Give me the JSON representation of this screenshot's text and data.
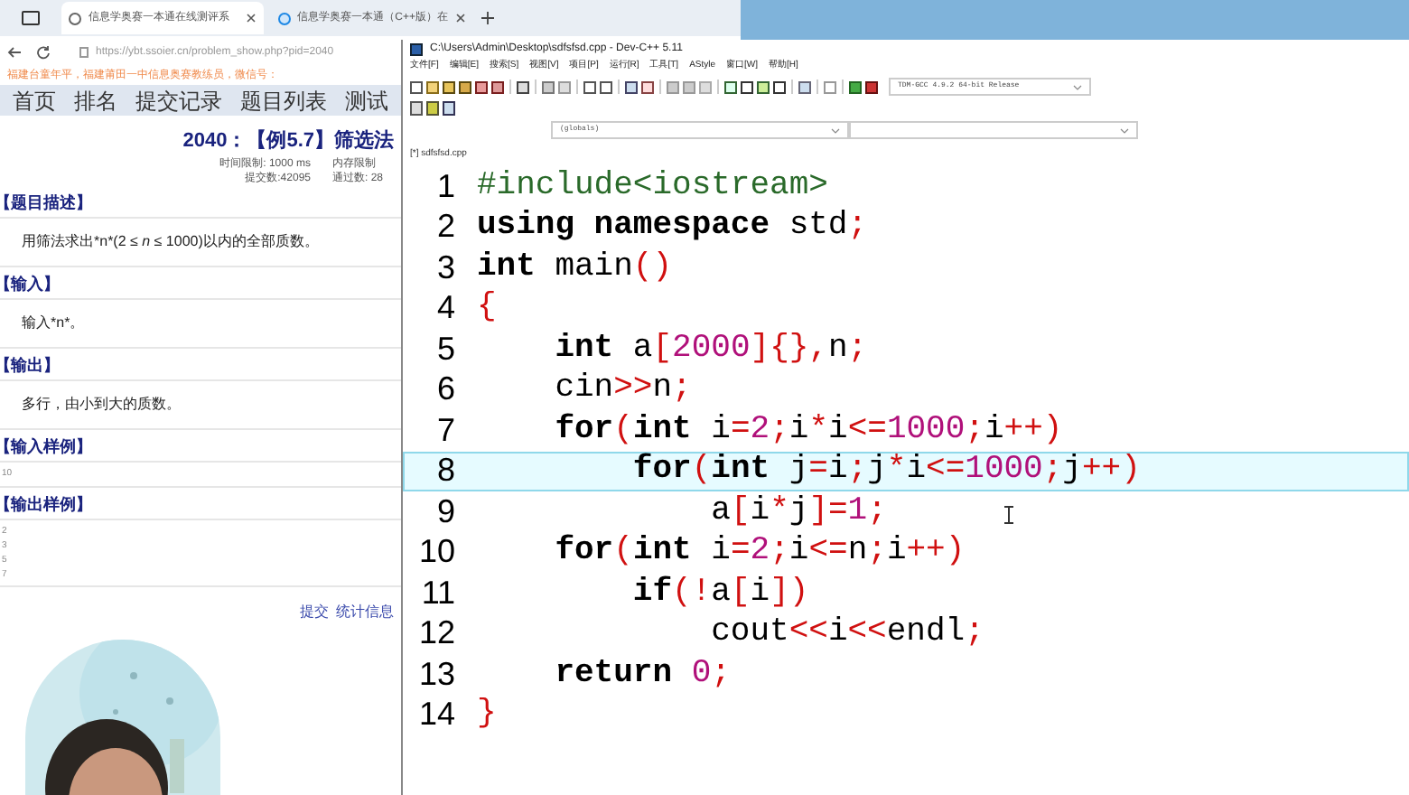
{
  "browser": {
    "tabs": [
      {
        "title": "信息学奥赛一本通在线测评系",
        "selected": true
      },
      {
        "title": "信息学奥赛一本通（C++版）在",
        "selected": false
      }
    ],
    "url": "https://ybt.ssoier.cn/problem_show.php?pid=2040",
    "notice": "福建台童年平，福建莆田一中信息奥赛教练员，微信号：",
    "nav": [
      {
        "label": "首页"
      },
      {
        "label": "排名"
      },
      {
        "label": "提交记录"
      },
      {
        "label": "题目列表"
      },
      {
        "label": "测试"
      }
    ],
    "problem": {
      "title": "2040：【例5.7】筛选法",
      "limits": [
        {
          "label": "时间限制: 1000 ms",
          "value": "内存限制"
        },
        {
          "label": "提交数:42095",
          "value": "通过数: 28"
        }
      ],
      "sections": [
        {
          "heading": "【题目描述】",
          "body": "用筛法求出*n*(2 ≤ *n* ≤ 1000)以内的全部质数。",
          "kind": "text"
        },
        {
          "heading": "【输入】",
          "body": "输入*n*。",
          "kind": "text"
        },
        {
          "heading": "【输出】",
          "body": "多行，由小到大的质数。",
          "kind": "text"
        },
        {
          "heading": "【输入样例】",
          "body": "10",
          "kind": "sample"
        },
        {
          "heading": "【输出样例】",
          "body": "2\n3\n5\n7",
          "kind": "sample"
        }
      ],
      "footer_links": [
        "提交",
        "统计信息"
      ]
    }
  },
  "editor": {
    "title": "C:\\Users\\Admin\\Desktop\\sdfsfsd.cpp - Dev-C++ 5.11",
    "menu": [
      "文件[F]",
      "编辑[E]",
      "搜索[S]",
      "视图[V]",
      "项目[P]",
      "运行[R]",
      "工具[T]",
      "AStyle",
      "窗口[W]",
      "帮助[H]"
    ],
    "compiler": "TDM-GCC 4.9.2 64-bit Release",
    "scope": "(globals)",
    "file_tab": "[*] sdfsfsd.cpp",
    "lines": [
      {
        "number": "1",
        "current": false,
        "tokens": [
          {
            "kind": "pre",
            "text": "#include<iostream>"
          }
        ]
      },
      {
        "number": "2",
        "current": false,
        "tokens": [
          {
            "kind": "kw",
            "text": "using namespace"
          },
          {
            "kind": "plain",
            "text": " std"
          },
          {
            "kind": "sym",
            "text": ";"
          }
        ]
      },
      {
        "number": "3",
        "current": false,
        "tokens": [
          {
            "kind": "kw",
            "text": "int"
          },
          {
            "kind": "plain",
            "text": " main"
          },
          {
            "kind": "sym",
            "text": "()"
          }
        ]
      },
      {
        "number": "4",
        "current": false,
        "tokens": [
          {
            "kind": "sym",
            "text": "{"
          }
        ]
      },
      {
        "number": "5",
        "current": false,
        "tokens": [
          {
            "kind": "kw",
            "text": "    int"
          },
          {
            "kind": "plain",
            "text": " a"
          },
          {
            "kind": "sym",
            "text": "["
          },
          {
            "kind": "num",
            "text": "2000"
          },
          {
            "kind": "sym",
            "text": "]{},"
          },
          {
            "kind": "plain",
            "text": "n"
          },
          {
            "kind": "sym",
            "text": ";"
          }
        ]
      },
      {
        "number": "6",
        "current": false,
        "tokens": [
          {
            "kind": "plain",
            "text": "    cin"
          },
          {
            "kind": "sym",
            "text": ">>"
          },
          {
            "kind": "plain",
            "text": "n"
          },
          {
            "kind": "sym",
            "text": ";"
          }
        ]
      },
      {
        "number": "7",
        "current": false,
        "tokens": [
          {
            "kind": "kw",
            "text": "    for"
          },
          {
            "kind": "sym",
            "text": "("
          },
          {
            "kind": "kw",
            "text": "int"
          },
          {
            "kind": "plain",
            "text": " i"
          },
          {
            "kind": "sym",
            "text": "="
          },
          {
            "kind": "num",
            "text": "2"
          },
          {
            "kind": "sym",
            "text": ";"
          },
          {
            "kind": "plain",
            "text": "i"
          },
          {
            "kind": "sym",
            "text": "*"
          },
          {
            "kind": "plain",
            "text": "i"
          },
          {
            "kind": "sym",
            "text": "<="
          },
          {
            "kind": "num",
            "text": "1000"
          },
          {
            "kind": "sym",
            "text": ";"
          },
          {
            "kind": "plain",
            "text": "i"
          },
          {
            "kind": "sym",
            "text": "++)"
          }
        ]
      },
      {
        "number": "8",
        "current": true,
        "tokens": [
          {
            "kind": "kw",
            "text": "        for"
          },
          {
            "kind": "sym",
            "text": "("
          },
          {
            "kind": "kw",
            "text": "int"
          },
          {
            "kind": "plain",
            "text": " j"
          },
          {
            "kind": "sym",
            "text": "="
          },
          {
            "kind": "plain",
            "text": "i"
          },
          {
            "kind": "sym",
            "text": ";"
          },
          {
            "kind": "plain",
            "text": "j"
          },
          {
            "kind": "sym",
            "text": "*"
          },
          {
            "kind": "plain",
            "text": "i"
          },
          {
            "kind": "sym",
            "text": "<="
          },
          {
            "kind": "num",
            "text": "1000"
          },
          {
            "kind": "sym",
            "text": ";"
          },
          {
            "kind": "plain",
            "text": "j"
          },
          {
            "kind": "sym",
            "text": "++)"
          }
        ]
      },
      {
        "number": "9",
        "current": false,
        "tokens": [
          {
            "kind": "plain",
            "text": "            a"
          },
          {
            "kind": "sym",
            "text": "["
          },
          {
            "kind": "plain",
            "text": "i"
          },
          {
            "kind": "sym",
            "text": "*"
          },
          {
            "kind": "plain",
            "text": "j"
          },
          {
            "kind": "sym",
            "text": "]="
          },
          {
            "kind": "num",
            "text": "1"
          },
          {
            "kind": "sym",
            "text": ";"
          }
        ]
      },
      {
        "number": "10",
        "current": false,
        "tokens": [
          {
            "kind": "kw",
            "text": "    for"
          },
          {
            "kind": "sym",
            "text": "("
          },
          {
            "kind": "kw",
            "text": "int"
          },
          {
            "kind": "plain",
            "text": " i"
          },
          {
            "kind": "sym",
            "text": "="
          },
          {
            "kind": "num",
            "text": "2"
          },
          {
            "kind": "sym",
            "text": ";"
          },
          {
            "kind": "plain",
            "text": "i"
          },
          {
            "kind": "sym",
            "text": "<="
          },
          {
            "kind": "plain",
            "text": "n"
          },
          {
            "kind": "sym",
            "text": ";"
          },
          {
            "kind": "plain",
            "text": "i"
          },
          {
            "kind": "sym",
            "text": "++)"
          }
        ]
      },
      {
        "number": "11",
        "current": false,
        "tokens": [
          {
            "kind": "kw",
            "text": "        if"
          },
          {
            "kind": "sym",
            "text": "(!"
          },
          {
            "kind": "plain",
            "text": "a"
          },
          {
            "kind": "sym",
            "text": "["
          },
          {
            "kind": "plain",
            "text": "i"
          },
          {
            "kind": "sym",
            "text": "])"
          }
        ]
      },
      {
        "number": "12",
        "current": false,
        "tokens": [
          {
            "kind": "plain",
            "text": "            cout"
          },
          {
            "kind": "sym",
            "text": "<<"
          },
          {
            "kind": "plain",
            "text": "i"
          },
          {
            "kind": "sym",
            "text": "<<"
          },
          {
            "kind": "plain",
            "text": "endl"
          },
          {
            "kind": "sym",
            "text": ";"
          }
        ]
      },
      {
        "number": "13",
        "current": false,
        "tokens": [
          {
            "kind": "kw",
            "text": "    return"
          },
          {
            "kind": "num",
            "text": " 0"
          },
          {
            "kind": "sym",
            "text": ";"
          }
        ]
      },
      {
        "number": "14",
        "current": false,
        "tokens": [
          {
            "kind": "sym",
            "text": "}"
          }
        ]
      }
    ]
  }
}
